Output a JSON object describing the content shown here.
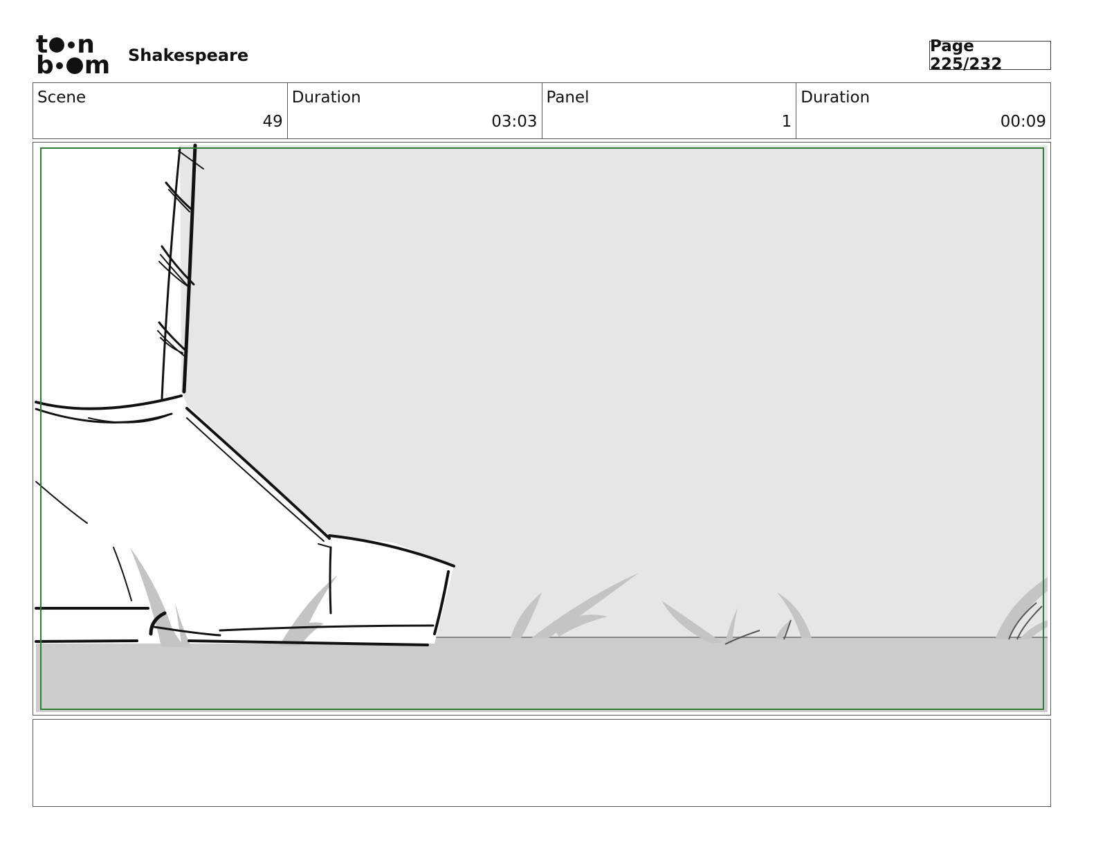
{
  "header": {
    "logo": {
      "line1": "toon",
      "line2": "boom"
    },
    "project_title": "Shakespeare",
    "page_label": "Page 225/232"
  },
  "info": {
    "scene_label": "Scene",
    "scene_value": "49",
    "scene_duration_label": "Duration",
    "scene_duration_value": "03:03",
    "panel_label": "Panel",
    "panel_value": "1",
    "panel_duration_label": "Duration",
    "panel_duration_value": "00:09"
  },
  "panel": {
    "safe_frame_color": "#2e7d32",
    "wall_color": "#e6e6e6",
    "ground_color": "#cccccc",
    "grass_color": "#c2c2c2",
    "ink_color": "#111111"
  },
  "caption": {
    "text": ""
  }
}
